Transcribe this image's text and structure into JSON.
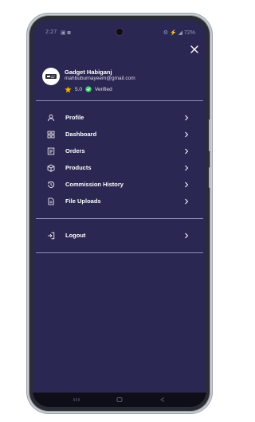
{
  "status_bar": {
    "time": "2:27",
    "left_icons": "▣ ◙",
    "right_text": "⚙ ⚡ ◢ 72%"
  },
  "drawer": {
    "close_icon": "close-icon",
    "profile": {
      "name": "Gadget Habiganj",
      "email": "mahbuburnayeem@gmail.com",
      "rating": "5.0",
      "verified_label": "Verified"
    },
    "menu": [
      {
        "label": "Profile",
        "icon": "user-icon"
      },
      {
        "label": "Dashboard",
        "icon": "dashboard-icon"
      },
      {
        "label": "Orders",
        "icon": "orders-icon"
      },
      {
        "label": "Products",
        "icon": "box-icon"
      },
      {
        "label": "Commission History",
        "icon": "history-icon"
      },
      {
        "label": "File Uploads",
        "icon": "file-icon"
      }
    ],
    "logout": {
      "label": "Logout",
      "icon": "logout-icon"
    }
  },
  "colors": {
    "drawer_bg": "#2b2753",
    "divider": "#8f8cb0",
    "text": "#ffffff",
    "star": "#f5b400",
    "verified": "#3ecf6e"
  }
}
